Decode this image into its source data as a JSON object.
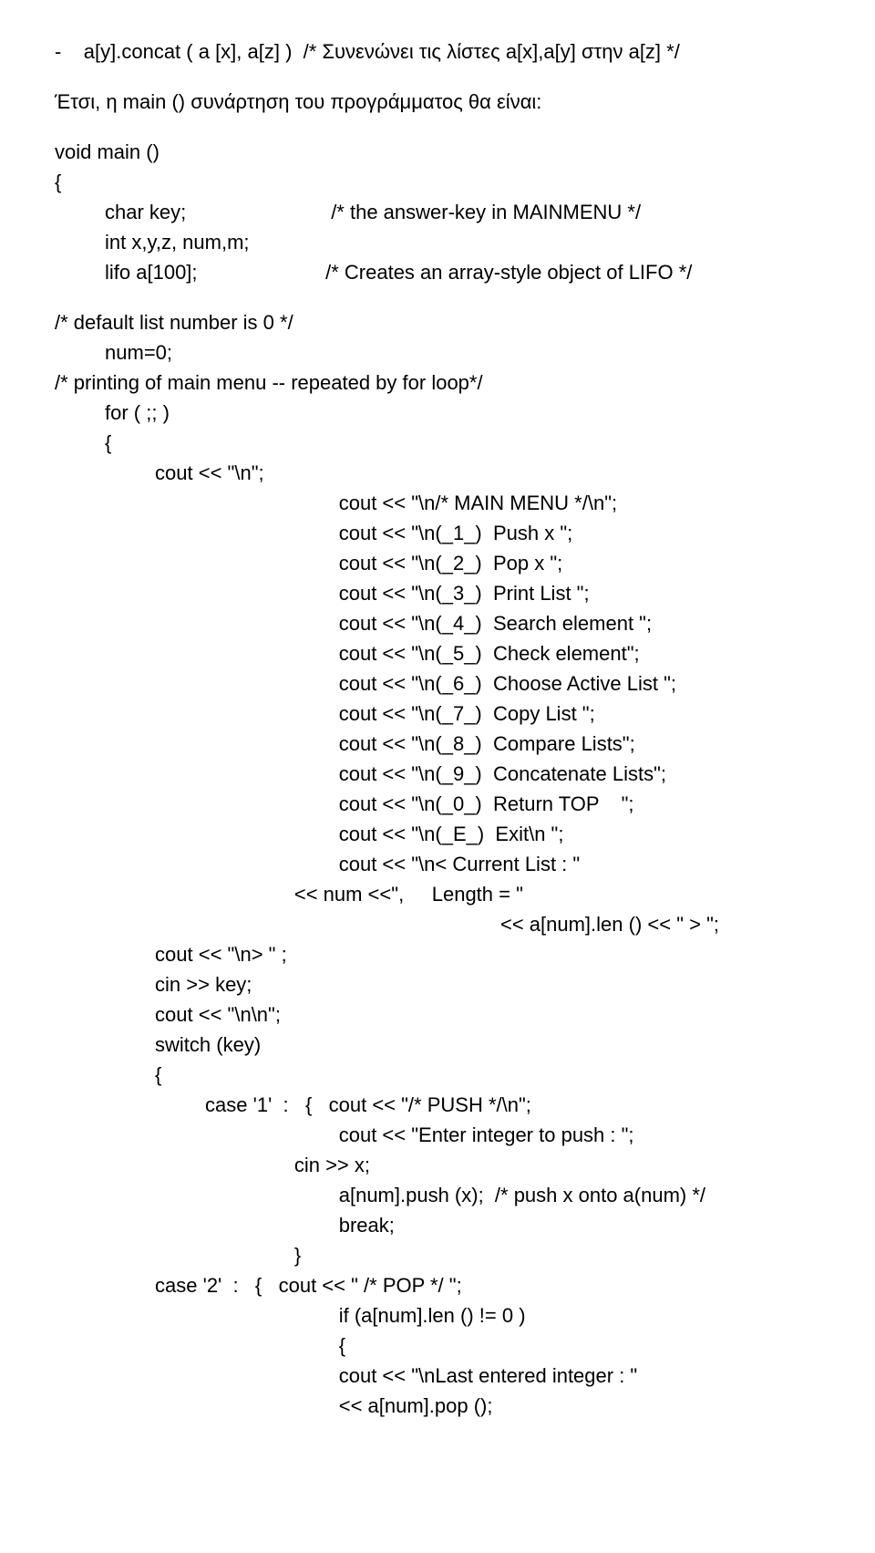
{
  "lines": [
    "-    a[y].concat ( a [x], a[z] )  /* Συνενώνει τις λίστες a[x],a[y] στην a[z] */",
    "",
    "Έτσι, η main () συνάρτηση του προγράμματος θα είναι:",
    "",
    "void main ()",
    "{",
    "         char key;                          /* the answer-key in MAINMENU */",
    "         int x,y,z, num,m;",
    "         lifo a[100];                       /* Creates an array-style object of LIFO */",
    "",
    "/* default list number is 0 */",
    "         num=0;",
    "/* printing of main menu -- repeated by for loop*/",
    "         for ( ;; )",
    "         {",
    "                  cout << \"\\n\";",
    "                                                   cout << \"\\n/* MAIN MENU */\\n\";",
    "                                                   cout << \"\\n(_1_)  Push x \";",
    "                                                   cout << \"\\n(_2_)  Pop x \";",
    "                                                   cout << \"\\n(_3_)  Print List \";",
    "                                                   cout << \"\\n(_4_)  Search element \";",
    "                                                   cout << \"\\n(_5_)  Check element\";",
    "                                                   cout << \"\\n(_6_)  Choose Active List \";",
    "                                                   cout << \"\\n(_7_)  Copy List \";",
    "                                                   cout << \"\\n(_8_)  Compare Lists\";",
    "                                                   cout << \"\\n(_9_)  Concatenate Lists\";",
    "                                                   cout << \"\\n(_0_)  Return TOP    \";",
    "                                                   cout << \"\\n(_E_)  Exit\\n \";",
    "                                                   cout << \"\\n< Current List : \"",
    "                                           << num <<\",     Length = \"",
    "                                                                                << a[num].len () << \" > \";",
    "                  cout << \"\\n> \" ;",
    "                  cin >> key;",
    "                  cout << \"\\n\\n\";",
    "                  switch (key)",
    "                  {",
    "                           case '1'  :   {   cout << \"/* PUSH */\\n\";",
    "                                                   cout << \"Enter integer to push : \";",
    "                                           cin >> x;",
    "                                                   a[num].push (x);  /* push x onto a(num) */",
    "                                                   break;",
    "                                           }",
    "                  case '2'  :   {   cout << \" /* POP */ \";",
    "                                                   if (a[num].len () != 0 )",
    "                                                   {",
    "                                                   cout << \"\\nLast entered integer : \"",
    "                                                   << a[num].pop ();"
  ]
}
